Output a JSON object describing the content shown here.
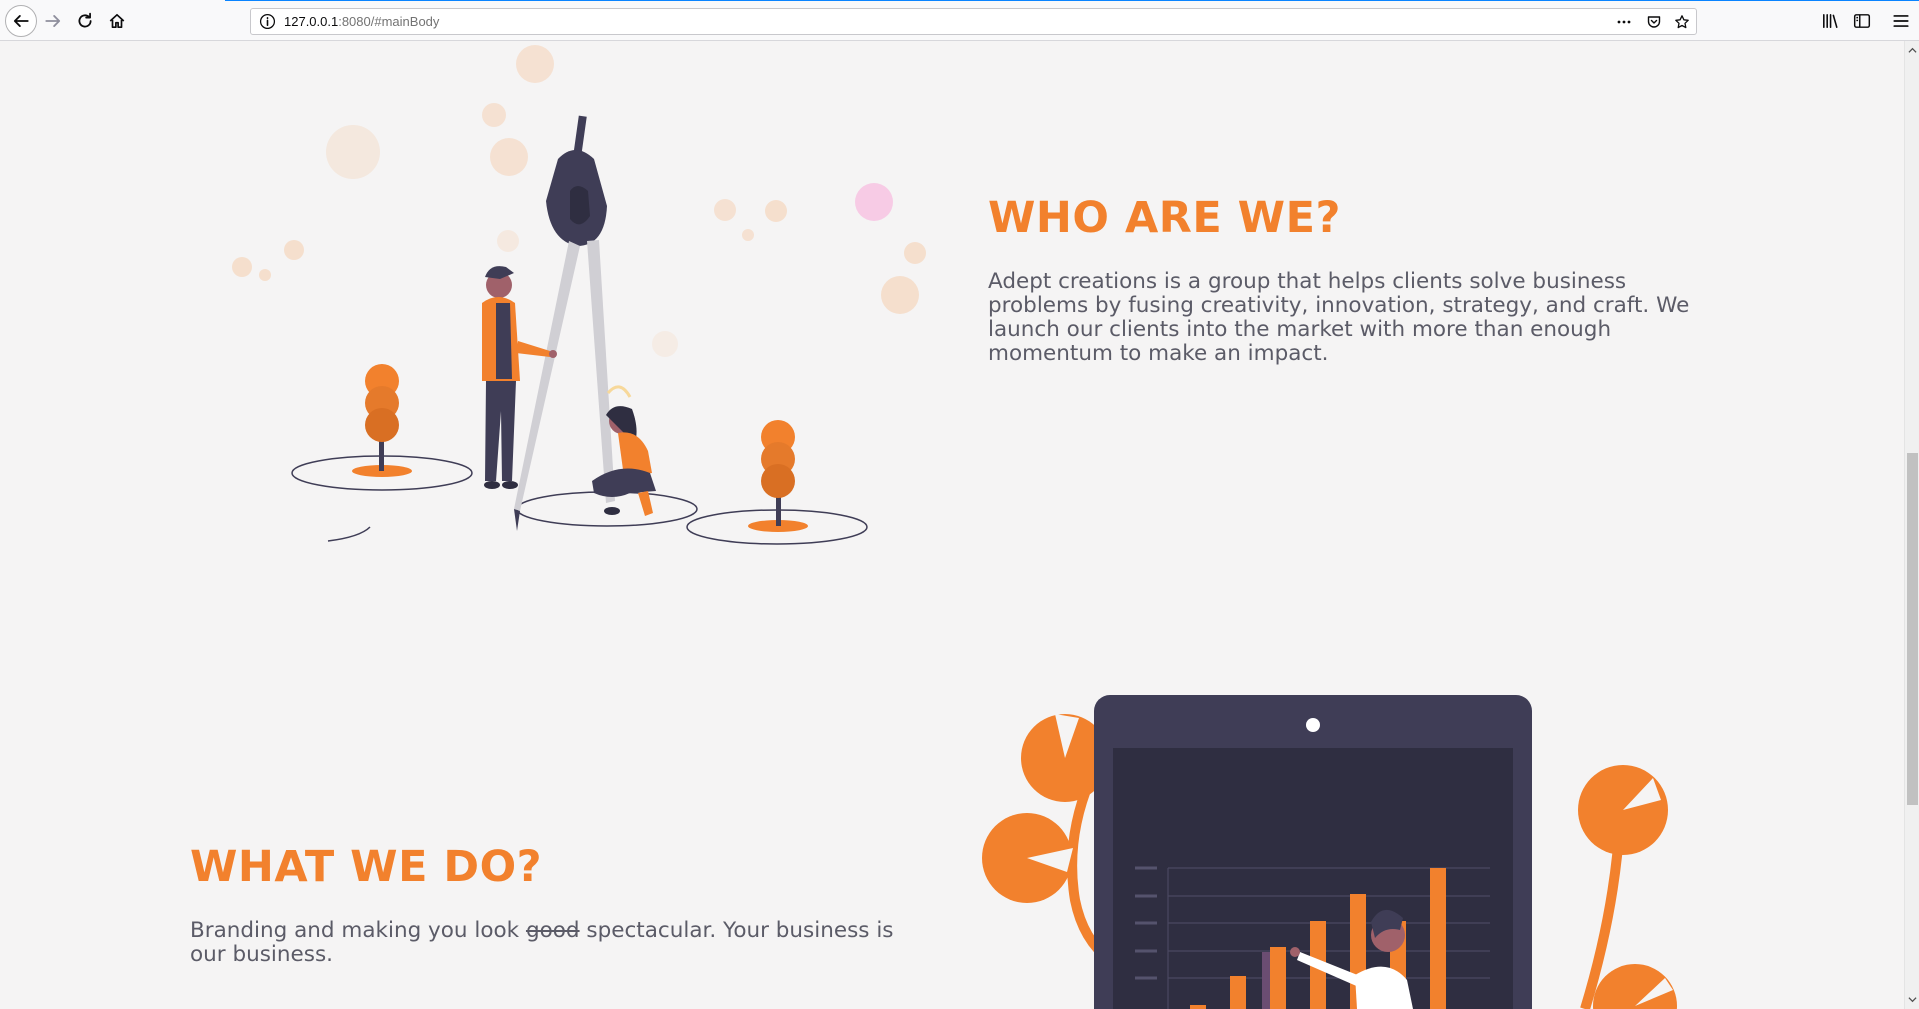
{
  "browser": {
    "url_host": "127.0.0.1",
    "url_rest": ":8080/#mainBody"
  },
  "about": {
    "heading": "WHO ARE WE?",
    "text": "Adept creations is a group that helps clients solve business problems by fusing creativity, innovation, strategy, and craft. We launch our clients into the market with more than enough momentum to make an impact."
  },
  "services": {
    "heading": "WHAT WE DO?",
    "text_before": "Branding and making you look ",
    "text_struck": "good",
    "text_after": " spectacular. Your business is our business."
  },
  "colors": {
    "accent": "#f2812d",
    "dark": "#3f3d56",
    "background": "#f5f4f4",
    "text": "#5b5b67"
  },
  "icons": [
    "back-arrow-icon",
    "forward-arrow-icon",
    "reload-icon",
    "home-icon",
    "info-icon",
    "more-actions-icon",
    "pocket-icon",
    "bookmark-star-icon",
    "library-icon",
    "sidebar-icon",
    "menu-icon"
  ]
}
